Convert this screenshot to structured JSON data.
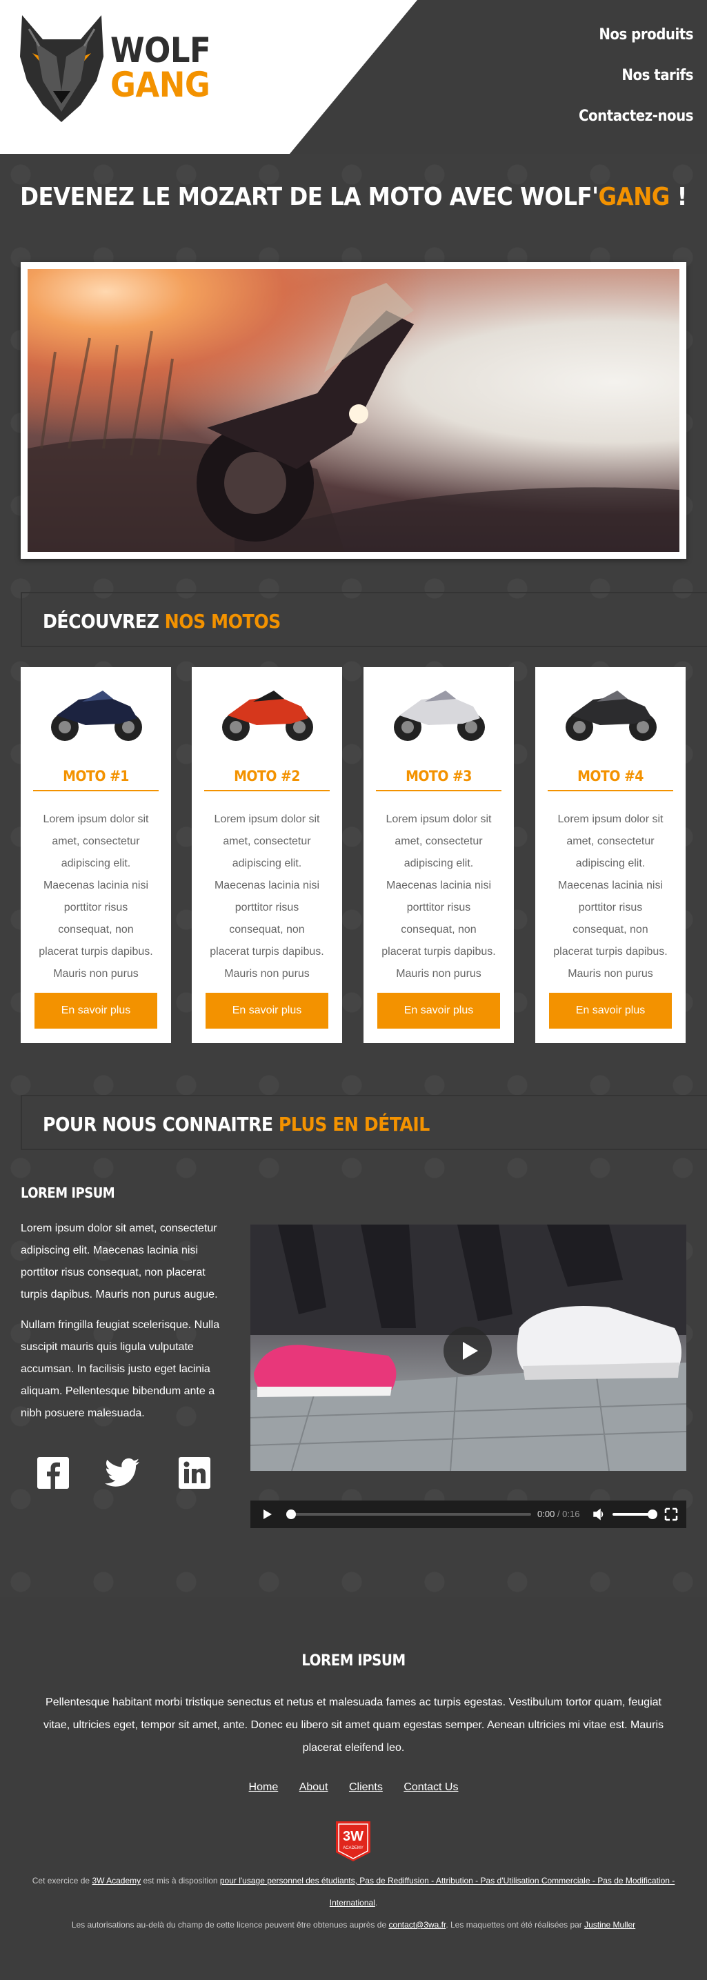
{
  "brand": {
    "line1": "WOLF",
    "line2": "GANG"
  },
  "nav": {
    "items": [
      "Nos produits",
      "Nos tarifs",
      "Contactez-nous"
    ]
  },
  "hero": {
    "title_part1": "DEVENEZ LE MOZART DE LA MOTO AVEC WOLF'",
    "title_accent": "GANG",
    "title_end": " !"
  },
  "motos_section": {
    "title_part1": "DÉCOUVREZ ",
    "title_accent": "NOS MOTOS"
  },
  "cards": [
    {
      "title": "MOTO #1",
      "text": "Lorem ipsum dolor sit amet, consectetur adipiscing elit. Maecenas lacinia nisi porttitor risus consequat, non placerat turpis dapibus. Mauris non purus augue.",
      "button": "En savoir plus"
    },
    {
      "title": "MOTO #2",
      "text": "Lorem ipsum dolor sit amet, consectetur adipiscing elit. Maecenas lacinia nisi porttitor risus consequat, non placerat turpis dapibus. Mauris non purus augue.",
      "button": "En savoir plus"
    },
    {
      "title": "MOTO #3",
      "text": "Lorem ipsum dolor sit amet, consectetur adipiscing elit. Maecenas lacinia nisi porttitor risus consequat, non placerat turpis dapibus. Mauris non purus augue.",
      "button": "En savoir plus"
    },
    {
      "title": "MOTO #4",
      "text": "Lorem ipsum dolor sit amet, consectetur adipiscing elit. Maecenas lacinia nisi porttitor risus consequat, non placerat turpis dapibus. Mauris non purus augue.",
      "button": "En savoir plus"
    }
  ],
  "about_section": {
    "title_part1": "POUR NOUS CONNAITRE ",
    "title_accent": "PLUS EN DÉTAIL"
  },
  "about": {
    "heading": "LOREM IPSUM",
    "para1": "Lorem ipsum dolor sit amet, consectetur adipiscing elit. Maecenas lacinia nisi porttitor risus consequat, non placerat turpis dapibus. Mauris non purus augue.",
    "para2": "Nullam fringilla feugiat scelerisque. Nulla suscipit mauris quis ligula vulputate accumsan. In facilisis justo eget lacinia aliquam. Pellentesque bibendum ante a nibh posuere malesuada."
  },
  "socials": [
    "facebook-icon",
    "twitter-icon",
    "linkedin-icon"
  ],
  "player": {
    "current": "0:00",
    "separator": " / ",
    "duration": "0:16",
    "progress": 0,
    "volume": 1
  },
  "footer": {
    "heading": "LOREM IPSUM",
    "text": "Pellentesque habitant morbi tristique senectus et netus et malesuada fames ac turpis egestas. Vestibulum tortor quam, feugiat vitae, ultricies eget, tempor sit amet, ante. Donec eu libero sit amet quam egestas semper. Aenean ultricies mi vitae est. Mauris placerat eleifend leo.",
    "links": [
      "Home",
      "About",
      "Clients",
      "Contact Us"
    ],
    "badge": {
      "line1": "3W",
      "line2": "ACADEMY"
    },
    "legal1_a": "Cet exercice de ",
    "legal1_link1": "3W Academy",
    "legal1_b": " est mis à disposition ",
    "legal1_link2": "pour l'usage personnel des étudiants, Pas de Rediffusion - Attribution - Pas d'Utilisation Commerciale - Pas de Modification - International",
    "legal1_c": ".",
    "legal2_a": "Les autorisations au-delà du champ de cette licence peuvent être obtenues auprès de ",
    "legal2_link1": "contact@3wa.fr",
    "legal2_b": ". Les maquettes ont été réalisées par ",
    "legal2_link2": "Justine Muller"
  },
  "colors": {
    "accent": "#f39200",
    "background": "#3e3e3e",
    "header_dark": "#3d3d3d",
    "card": "#ffffff"
  }
}
